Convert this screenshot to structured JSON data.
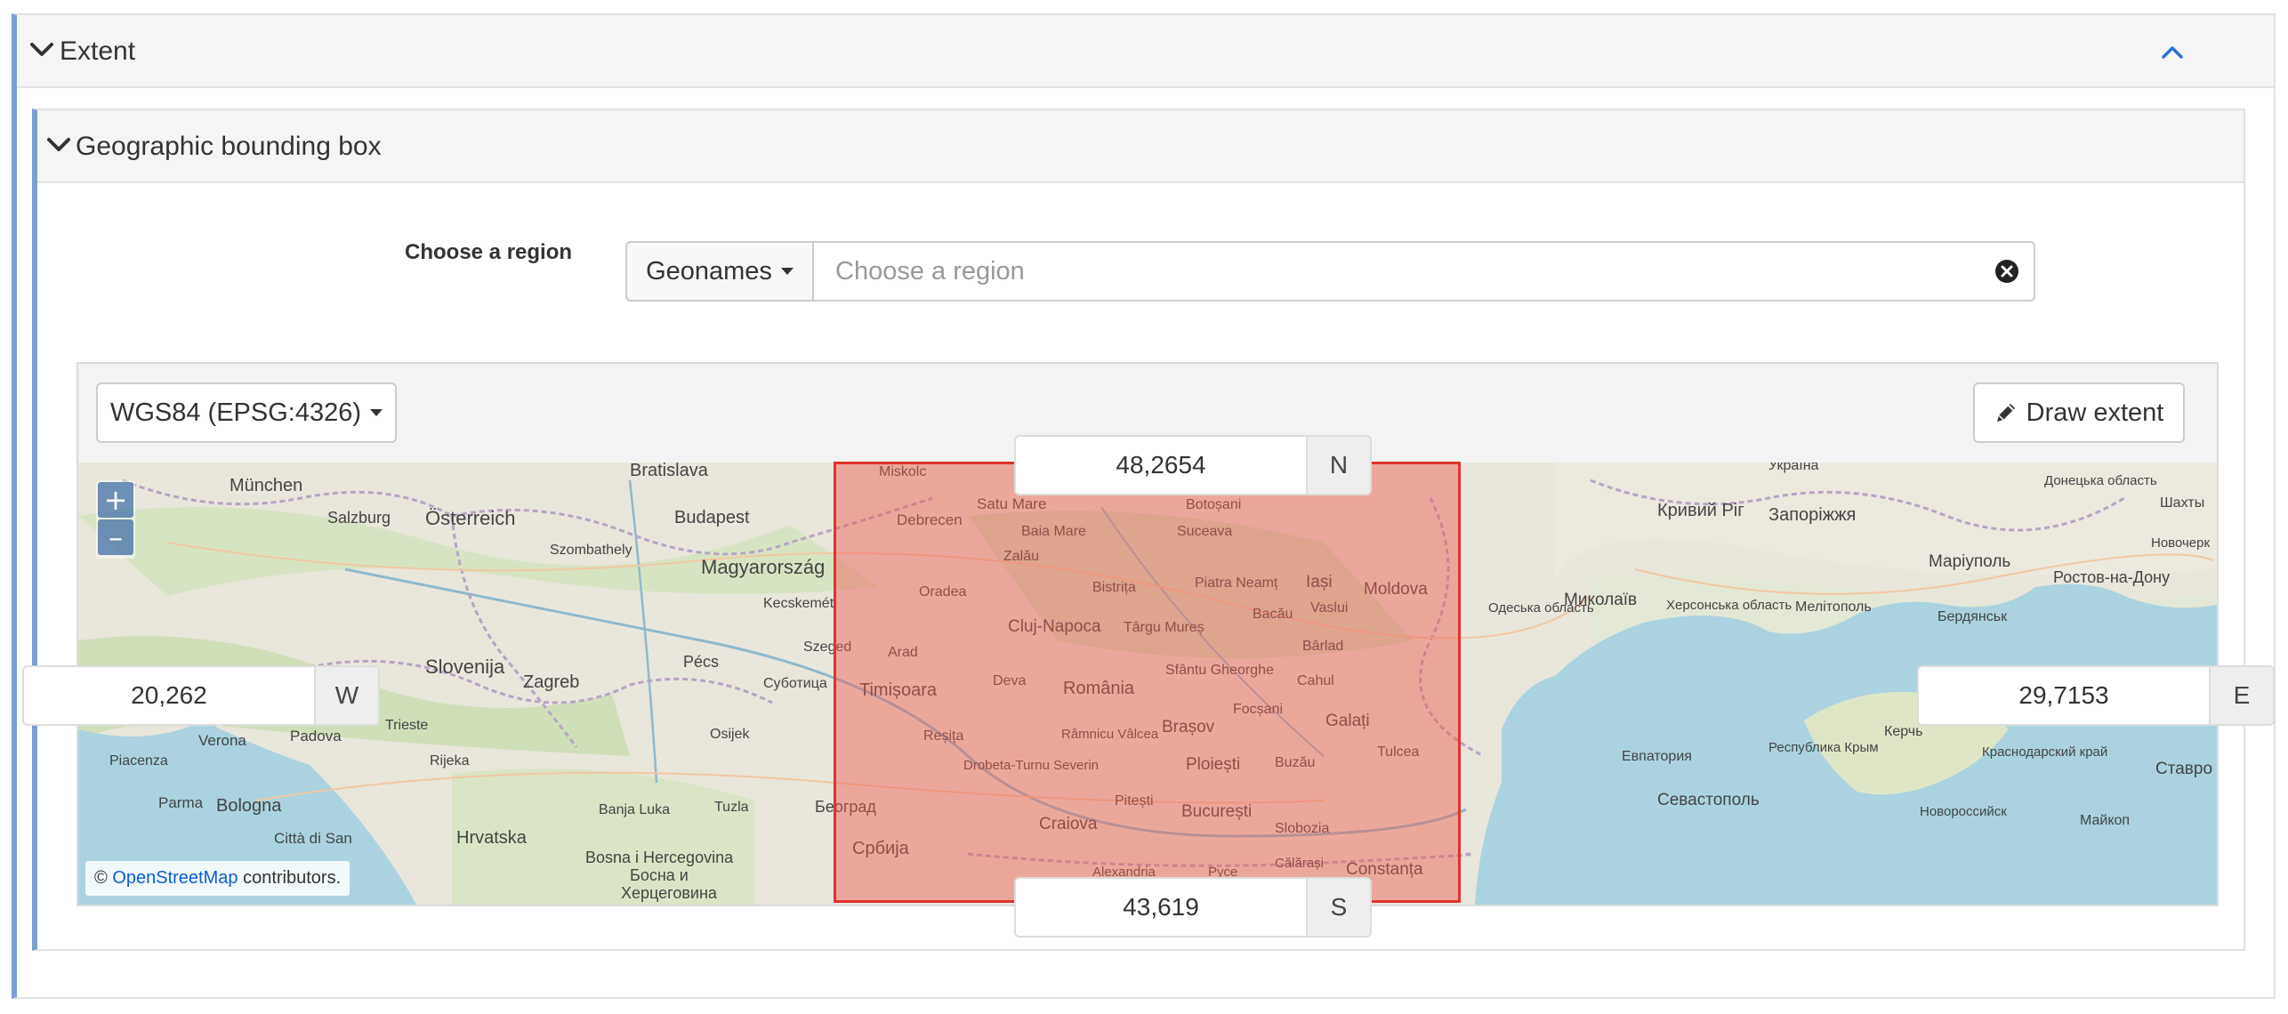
{
  "outer_section": {
    "title": "Extent"
  },
  "inner_section": {
    "title": "Geographic bounding box"
  },
  "region": {
    "label": "Choose a region",
    "source_button": "Geonames",
    "placeholder": "Choose a region",
    "value": ""
  },
  "map": {
    "crs_label": "WGS84 (EPSG:4326)",
    "draw_label": "Draw extent",
    "zoom_in": "+",
    "zoom_out": "–",
    "attribution_prefix": "©",
    "attribution_link": "OpenStreetMap",
    "attribution_suffix": "contributors."
  },
  "coords": {
    "north": {
      "value": "48,2654",
      "label": "N"
    },
    "south": {
      "value": "43,619",
      "label": "S"
    },
    "west": {
      "value": "20,262",
      "label": "W"
    },
    "east": {
      "value": "29,7153",
      "label": "E"
    }
  },
  "map_places": [
    "Bratislava",
    "München",
    "Salzburg",
    "Österreich",
    "Budapest",
    "Magyarország",
    "Szombathely",
    "Kecskemét",
    "Slovenija",
    "Zagreb",
    "Pécs",
    "Szeged",
    "Суботица",
    "Trieste",
    "Rijeka",
    "Verona",
    "Padova",
    "Bologna",
    "Parma",
    "Piacenza",
    "Città di San",
    "Hrvatska",
    "Banja Luka",
    "Tuzla",
    "Bosna i Hercegovina",
    "Босна и",
    "Херцеговина",
    "Osijek",
    "Београд",
    "Србија",
    "Miskolc",
    "Debrecen",
    "Satu Mare",
    "Baia Mare",
    "Botoșani",
    "Suceava",
    "Zalău",
    "Oradea",
    "Bistrița",
    "Piatra Neamț",
    "Iași",
    "Cluj-Napoca",
    "Târgu Mureș",
    "Bacău",
    "Vaslui",
    "Moldova",
    "Arad",
    "Timișoara",
    "Deva",
    "România",
    "Sfântu Gheorghe",
    "Bârlad",
    "Cahul",
    "Focșani",
    "Reșița",
    "Râmnicu Vâlcea",
    "Brașov",
    "Galați",
    "Tulcea",
    "Drobeta-Turnu Severin",
    "Ploiești",
    "Buzău",
    "Pitești",
    "Craiova",
    "București",
    "Slobozia",
    "Constanța",
    "Călărași",
    "Alexandria",
    "Русе",
    "Україна",
    "Кривий Ріг",
    "Запоріжжя",
    "Миколаїв",
    "Херсонська область",
    "Мелітополь",
    "Маріуполь",
    "Ростов-на-Дону",
    "Бердянськ",
    "Одеська область",
    "Евпатория",
    "Республика Крым",
    "Керчь",
    "Севастополь",
    "Новороссийск",
    "Краснодарский край",
    "Майкоп",
    "Ставро",
    "Шахты",
    "Новочерк",
    "Донецька область"
  ],
  "colors": {
    "accent_border": "#7b9fd0",
    "bbox_stroke": "#e0332b",
    "bbox_fill": "rgba(240,90,80,0.45)",
    "link": "#0a5ecb"
  }
}
